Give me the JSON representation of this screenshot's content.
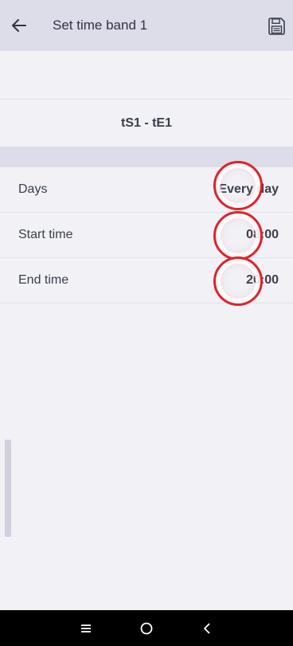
{
  "appbar": {
    "title": "Set time band 1",
    "back_icon": "arrow-left-icon",
    "save_icon": "floppy-disk-icon"
  },
  "band": {
    "name": "tS1 - tE1"
  },
  "settings": [
    {
      "label": "Days",
      "value": "Every day"
    },
    {
      "label": "Start time",
      "value": "08:00"
    },
    {
      "label": "End time",
      "value": "20:00"
    }
  ],
  "navbar": {
    "icons": [
      "menu-icon",
      "home-icon",
      "back-chevron-icon"
    ]
  },
  "colors": {
    "appbar_bg": "#dcdde9",
    "page_bg": "#f1f1f6",
    "highlight": "#e0222a"
  }
}
